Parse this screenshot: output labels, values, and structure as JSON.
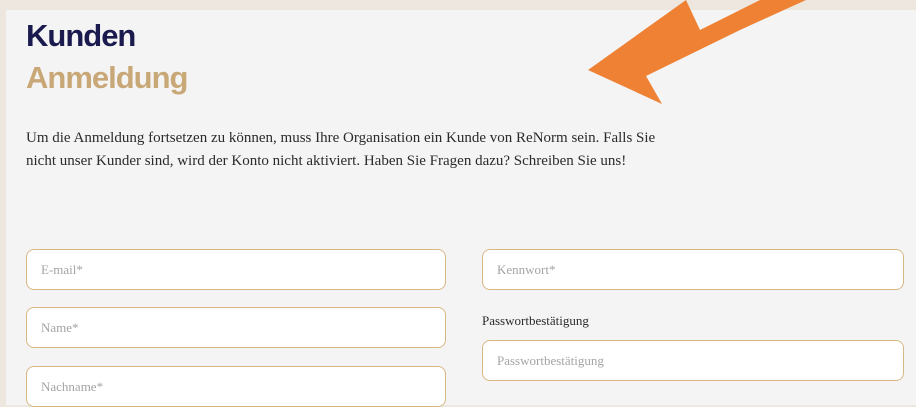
{
  "header": {
    "title_line1": "Kunden",
    "title_line2": "Anmeldung"
  },
  "intro": {
    "line1": "Um die Anmeldung fortsetzen zu können, muss Ihre Organisation ein Kunde von ReNorm sein. Falls Sie",
    "line2": "nicht unser Kunder sind, wird der Konto nicht aktiviert. Haben Sie Fragen dazu? Schreiben Sie uns!"
  },
  "form": {
    "email": {
      "placeholder": "E-mail*",
      "value": ""
    },
    "name": {
      "placeholder": "Name*",
      "value": ""
    },
    "lastname": {
      "placeholder": "Nachname*",
      "value": ""
    },
    "password": {
      "placeholder": "Kennwort*",
      "value": ""
    },
    "password_confirm": {
      "label": "Passwortbestätigung",
      "placeholder": "Passwortbestätigung",
      "value": ""
    }
  },
  "colors": {
    "title_primary": "#1a1a4e",
    "title_secondary": "#c9a877",
    "field_border": "#d7b885",
    "arrow": "#ee8134"
  },
  "annotation": {
    "icon": "arrow-pointing-icon"
  }
}
